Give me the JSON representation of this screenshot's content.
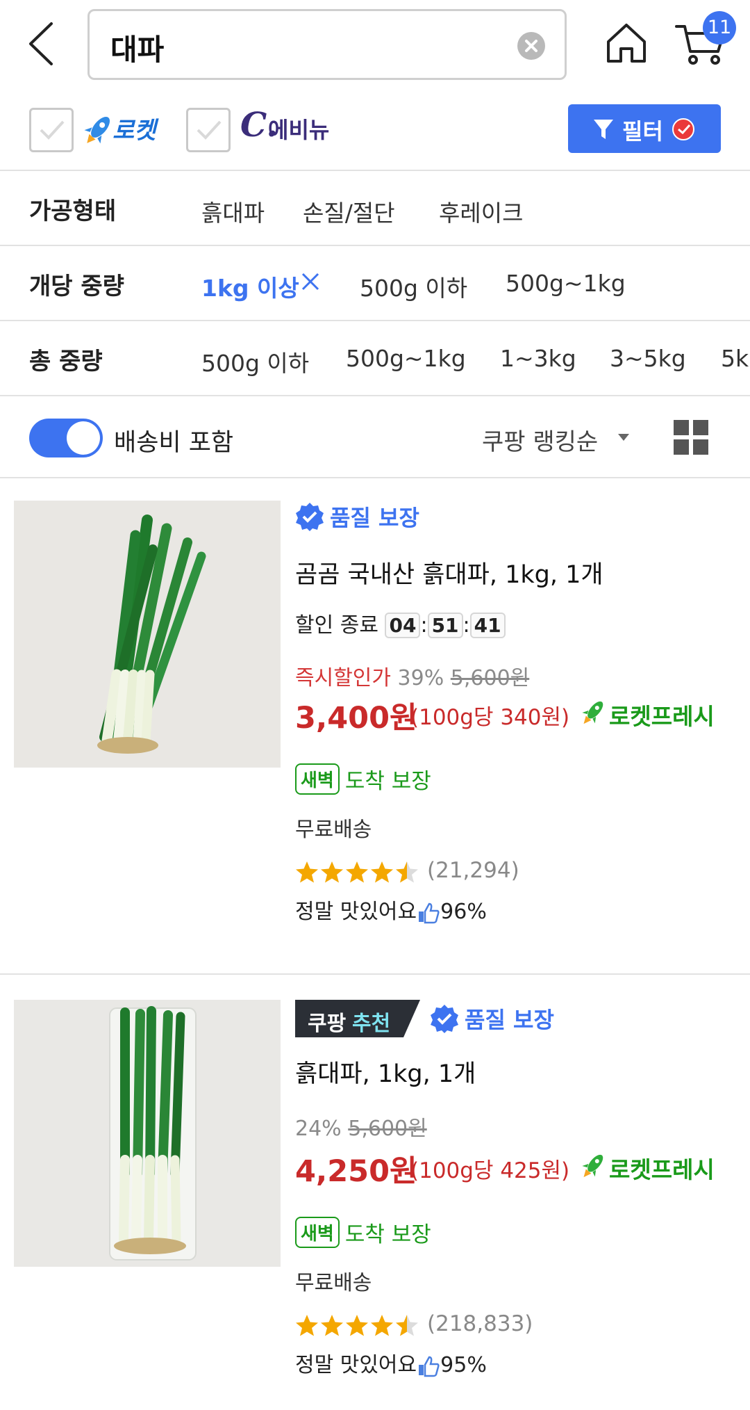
{
  "header": {
    "search_query": "대파",
    "cart_count": "11"
  },
  "brand_filters": {
    "rocket_label": "로켓",
    "evnew_prefix": "C.",
    "evnew_label": "에비뉴",
    "filter_label": "필터"
  },
  "attributes": [
    {
      "title": "가공형태",
      "options": [
        "흙대파",
        "손질/절단",
        "후레이크"
      ]
    },
    {
      "title": "개당 중량",
      "options": [
        "1kg 이상",
        "500g 이하",
        "500g~1kg"
      ],
      "selected": "1kg 이상"
    },
    {
      "title": "총 중량",
      "options": [
        "500g 이하",
        "500g~1kg",
        "1~3kg",
        "3~5kg",
        "5k"
      ]
    }
  ],
  "sort_bar": {
    "shipping_toggle_label": "배송비 포함",
    "shipping_toggle_on": true,
    "sort_label": "쿠팡 랭킹순"
  },
  "products": [
    {
      "quality_label": "품질 보장",
      "title": "곰곰 국내산 흙대파, 1kg, 1개",
      "timer_label": "할인 종료",
      "timer": [
        "04",
        "51",
        "41"
      ],
      "instant_label": "즉시할인가",
      "discount_rate": "39%",
      "original_price": "5,600원",
      "price": "3,400원",
      "unit_price": "(100g당 340원)",
      "delivery_label": "로켓프레시",
      "dawn_badge": "새벽",
      "dawn_text": "도착 보장",
      "shipping": "무료배송",
      "rating": 4.5,
      "review_count": "(21,294)",
      "taste_label": "정말 맛있어요",
      "taste_percent": "96%"
    },
    {
      "recommend_part1": "쿠팡",
      "recommend_part2": "추천",
      "quality_label": "품질 보장",
      "title": "흙대파, 1kg, 1개",
      "discount_rate": "24%",
      "original_price": "5,600원",
      "price": "4,250원",
      "unit_price": "(100g당 425원)",
      "delivery_label": "로켓프레시",
      "dawn_badge": "새벽",
      "dawn_text": "도착 보장",
      "shipping": "무료배송",
      "rating": 4.5,
      "review_count": "(218,833)",
      "taste_label": "정말 맛있어요",
      "taste_percent": "95%"
    }
  ],
  "colors": {
    "accent": "#3d73f0",
    "price_red": "#c92a2a",
    "rocket_green": "#1a9a1a"
  }
}
